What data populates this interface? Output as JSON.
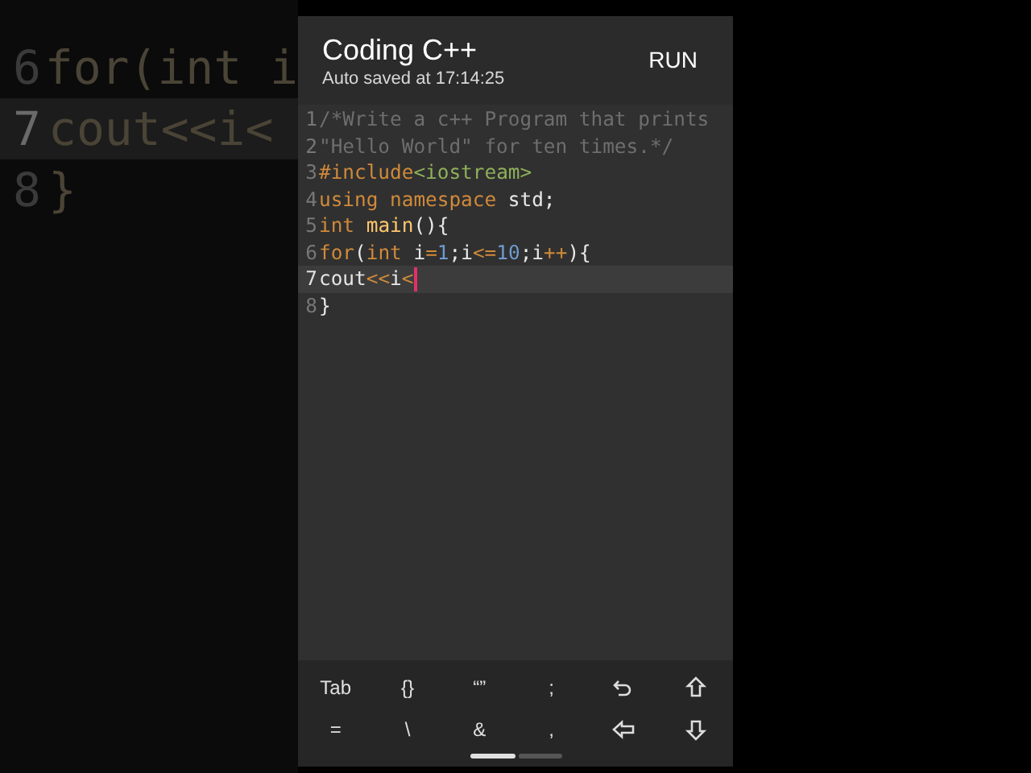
{
  "background_echo": {
    "lines": [
      {
        "number": "6",
        "text": "for(int i",
        "current": false
      },
      {
        "number": "7",
        "text": "cout<<i<",
        "current": true
      },
      {
        "number": "8",
        "text": "}",
        "current": false
      }
    ]
  },
  "app_bar": {
    "title": "Coding C++",
    "subtitle": "Auto saved at 17:14:25",
    "action": "RUN"
  },
  "editor": {
    "lines": [
      {
        "number": "1",
        "current": false,
        "tokens": [
          {
            "kind": "comment",
            "text": "/*Write a c++ Program that prints"
          }
        ]
      },
      {
        "number": "2",
        "current": false,
        "tokens": [
          {
            "kind": "comment",
            "text": "\"Hello World\" for ten times.*/"
          }
        ]
      },
      {
        "number": "3",
        "current": false,
        "tokens": [
          {
            "kind": "keyword",
            "text": "#include"
          },
          {
            "kind": "string",
            "text": "<iostream>"
          }
        ]
      },
      {
        "number": "4",
        "current": false,
        "tokens": [
          {
            "kind": "keyword",
            "text": "using namespace"
          },
          {
            "kind": "plain",
            "text": " std;"
          }
        ]
      },
      {
        "number": "5",
        "current": false,
        "tokens": [
          {
            "kind": "keyword",
            "text": "int"
          },
          {
            "kind": "function",
            "text": " main"
          },
          {
            "kind": "plain",
            "text": "(){"
          }
        ]
      },
      {
        "number": "6",
        "current": false,
        "tokens": [
          {
            "kind": "keyword",
            "text": "for"
          },
          {
            "kind": "plain",
            "text": "("
          },
          {
            "kind": "keyword",
            "text": "int"
          },
          {
            "kind": "plain",
            "text": " i"
          },
          {
            "kind": "keyword",
            "text": "="
          },
          {
            "kind": "number",
            "text": "1"
          },
          {
            "kind": "plain",
            "text": ";i"
          },
          {
            "kind": "keyword",
            "text": "<="
          },
          {
            "kind": "number",
            "text": "10"
          },
          {
            "kind": "plain",
            "text": ";i"
          },
          {
            "kind": "keyword",
            "text": "++"
          },
          {
            "kind": "plain",
            "text": "){"
          }
        ]
      },
      {
        "number": "7",
        "current": true,
        "tokens": [
          {
            "kind": "plain",
            "text": "cout"
          },
          {
            "kind": "keyword",
            "text": "<<"
          },
          {
            "kind": "plain",
            "text": "i"
          },
          {
            "kind": "keyword",
            "text": "<"
          }
        ]
      },
      {
        "number": "8",
        "current": false,
        "tokens": [
          {
            "kind": "plain",
            "text": "}"
          }
        ]
      }
    ]
  },
  "keyboard_bar": {
    "rows": [
      [
        {
          "kind": "text",
          "label": "Tab"
        },
        {
          "kind": "text",
          "label": "{}"
        },
        {
          "kind": "text",
          "label": "“”"
        },
        {
          "kind": "text",
          "label": ";"
        },
        {
          "kind": "undo"
        },
        {
          "kind": "up"
        }
      ],
      [
        {
          "kind": "text",
          "label": "="
        },
        {
          "kind": "text",
          "label": "\\"
        },
        {
          "kind": "text",
          "label": "&"
        },
        {
          "kind": "text",
          "label": ","
        },
        {
          "kind": "left"
        },
        {
          "kind": "down"
        }
      ]
    ]
  }
}
